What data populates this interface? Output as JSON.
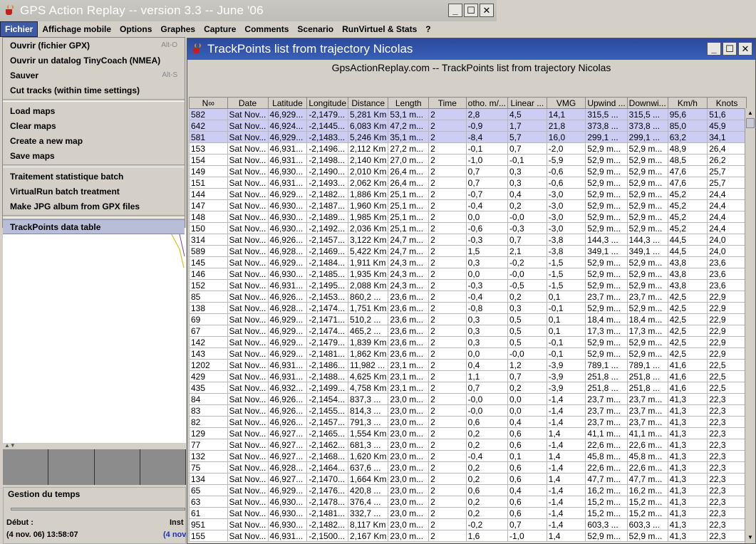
{
  "main_window": {
    "title": "GPS Action Replay -- version 3.3 -- June '06"
  },
  "menubar": [
    "Fichier",
    "Affichage mobile",
    "Options",
    "Graphes",
    "Capture",
    "Comments",
    "Scenario",
    "RunVirtuel & Stats",
    "?"
  ],
  "file_menu": {
    "items": [
      {
        "label": "Ouvrir (fichier GPX)",
        "shortcut": "Alt-O"
      },
      {
        "label": "Ouvrir un datalog TinyCoach (NMEA)",
        "shortcut": ""
      },
      {
        "label": "Sauver",
        "shortcut": "Alt-S"
      },
      {
        "label": "Cut tracks (within time settings)",
        "shortcut": ""
      },
      {
        "sep": true
      },
      {
        "label": "Load maps",
        "shortcut": ""
      },
      {
        "label": "Clear maps",
        "shortcut": ""
      },
      {
        "label": "Create a new map",
        "shortcut": ""
      },
      {
        "label": "Save maps",
        "shortcut": ""
      },
      {
        "sep": true
      },
      {
        "label": "Traitement statistique batch",
        "shortcut": ""
      },
      {
        "label": "VirtualRun batch treatment",
        "shortcut": ""
      },
      {
        "label": "Make JPG album from GPX files",
        "shortcut": ""
      },
      {
        "sep": true
      },
      {
        "label": "TrackPoints data table",
        "shortcut": "",
        "selected": true
      }
    ]
  },
  "time_panel": {
    "title": "Gestion du temps",
    "start_label": "Début :",
    "start_value": "(4 nov. 06) 13:58:07",
    "inst_label": "Inst",
    "inst_value": "(4 nov"
  },
  "trackpoints_window": {
    "title": "TrackPoints list from trajectory Nicolas",
    "subtitle": "GpsActionReplay.com -- TrackPoints list from trajectory Nicolas",
    "columns": [
      "N∞",
      "Date",
      "Latitude",
      "Longitude",
      "Distance",
      "Length",
      "Time",
      "otho. m/...",
      "Linear ...",
      "VMG",
      "Upwind ...",
      "Downwi...",
      "Km/h",
      "Knots"
    ],
    "rows": [
      [
        "582",
        "Sat Nov...",
        "46,929...",
        "-2,1479...",
        "5,281 Km",
        "53,1 m...",
        "2",
        "2,8",
        "4,5",
        "14,1",
        "315,5 ...",
        "315,5 ...",
        "95,6",
        "51,6"
      ],
      [
        "642",
        "Sat Nov...",
        "46,924...",
        "-2,1445...",
        "6,083 Km",
        "47,2 m...",
        "2",
        "-0,9",
        "1,7",
        "21,8",
        "373,8 ...",
        "373,8 ...",
        "85,0",
        "45,9"
      ],
      [
        "581",
        "Sat Nov...",
        "46,929...",
        "-2,1483...",
        "5,246 Km",
        "35,1 m...",
        "2",
        "-8,4",
        "5,7",
        "16,0",
        "299,1 ...",
        "299,1 ...",
        "63,2",
        "34,1"
      ],
      [
        "153",
        "Sat Nov...",
        "46,931...",
        "-2,1496...",
        "2,112 Km",
        "27,2 m...",
        "2",
        "-0,1",
        "0,7",
        "-2,0",
        "52,9 m...",
        "52,9 m...",
        "48,9",
        "26,4"
      ],
      [
        "154",
        "Sat Nov...",
        "46,931...",
        "-2,1498...",
        "2,140 Km",
        "27,0 m...",
        "2",
        "-1,0",
        "-0,1",
        "-5,9",
        "52,9 m...",
        "52,9 m...",
        "48,5",
        "26,2"
      ],
      [
        "149",
        "Sat Nov...",
        "46,930...",
        "-2,1490...",
        "2,010 Km",
        "26,4 m...",
        "2",
        "0,7",
        "0,3",
        "-0,6",
        "52,9 m...",
        "52,9 m...",
        "47,6",
        "25,7"
      ],
      [
        "151",
        "Sat Nov...",
        "46,931...",
        "-2,1493...",
        "2,062 Km",
        "26,4 m...",
        "2",
        "0,7",
        "0,3",
        "-0,6",
        "52,9 m...",
        "52,9 m...",
        "47,6",
        "25,7"
      ],
      [
        "144",
        "Sat Nov...",
        "46,929...",
        "-2,1482...",
        "1,886 Km",
        "25,1 m...",
        "2",
        "-0,7",
        "0,4",
        "-3,0",
        "52,9 m...",
        "52,9 m...",
        "45,2",
        "24,4"
      ],
      [
        "147",
        "Sat Nov...",
        "46,930...",
        "-2,1487...",
        "1,960 Km",
        "25,1 m...",
        "2",
        "-0,4",
        "0,2",
        "-3,0",
        "52,9 m...",
        "52,9 m...",
        "45,2",
        "24,4"
      ],
      [
        "148",
        "Sat Nov...",
        "46,930...",
        "-2,1489...",
        "1,985 Km",
        "25,1 m...",
        "2",
        "0,0",
        "-0,0",
        "-3,0",
        "52,9 m...",
        "52,9 m...",
        "45,2",
        "24,4"
      ],
      [
        "150",
        "Sat Nov...",
        "46,930...",
        "-2,1492...",
        "2,036 Km",
        "25,1 m...",
        "2",
        "-0,6",
        "-0,3",
        "-3,0",
        "52,9 m...",
        "52,9 m...",
        "45,2",
        "24,4"
      ],
      [
        "314",
        "Sat Nov...",
        "46,926...",
        "-2,1457...",
        "3,122 Km",
        "24,7 m...",
        "2",
        "-0,3",
        "0,7",
        "-3,8",
        "144,3 ...",
        "144,3 ...",
        "44,5",
        "24,0"
      ],
      [
        "589",
        "Sat Nov...",
        "46,928...",
        "-2,1469...",
        "5,422 Km",
        "24,7 m...",
        "2",
        "1,5",
        "2,1",
        "-3,8",
        "349,1 ...",
        "349,1 ...",
        "44,5",
        "24,0"
      ],
      [
        "145",
        "Sat Nov...",
        "46,929...",
        "-2,1484...",
        "1,911 Km",
        "24,3 m...",
        "2",
        "0,3",
        "-0,2",
        "-1,5",
        "52,9 m...",
        "52,9 m...",
        "43,8",
        "23,6"
      ],
      [
        "146",
        "Sat Nov...",
        "46,930...",
        "-2,1485...",
        "1,935 Km",
        "24,3 m...",
        "2",
        "0,0",
        "-0,0",
        "-1,5",
        "52,9 m...",
        "52,9 m...",
        "43,8",
        "23,6"
      ],
      [
        "152",
        "Sat Nov...",
        "46,931...",
        "-2,1495...",
        "2,088 Km",
        "24,3 m...",
        "2",
        "-0,3",
        "-0,5",
        "-1,5",
        "52,9 m...",
        "52,9 m...",
        "43,8",
        "23,6"
      ],
      [
        "85",
        "Sat Nov...",
        "46,926...",
        "-2,1453...",
        "860,2 ...",
        "23,6 m...",
        "2",
        "-0,4",
        "0,2",
        "0,1",
        "23,7 m...",
        "23,7 m...",
        "42,5",
        "22,9"
      ],
      [
        "138",
        "Sat Nov...",
        "46,928...",
        "-2,1474...",
        "1,751 Km",
        "23,6 m...",
        "2",
        "-0,8",
        "0,3",
        "-0,1",
        "52,9 m...",
        "52,9 m...",
        "42,5",
        "22,9"
      ],
      [
        "69",
        "Sat Nov...",
        "46,929...",
        "-2,1471...",
        "510,2 ...",
        "23,6 m...",
        "2",
        "0,3",
        "0,5",
        "0,1",
        "18,4 m...",
        "18,4 m...",
        "42,5",
        "22,9"
      ],
      [
        "67",
        "Sat Nov...",
        "46,929...",
        "-2,1474...",
        "465,2 ...",
        "23,6 m...",
        "2",
        "0,3",
        "0,5",
        "0,1",
        "17,3 m...",
        "17,3 m...",
        "42,5",
        "22,9"
      ],
      [
        "142",
        "Sat Nov...",
        "46,929...",
        "-2,1479...",
        "1,839 Km",
        "23,6 m...",
        "2",
        "0,3",
        "0,5",
        "-0,1",
        "52,9 m...",
        "52,9 m...",
        "42,5",
        "22,9"
      ],
      [
        "143",
        "Sat Nov...",
        "46,929...",
        "-2,1481...",
        "1,862 Km",
        "23,6 m...",
        "2",
        "0,0",
        "-0,0",
        "-0,1",
        "52,9 m...",
        "52,9 m...",
        "42,5",
        "22,9"
      ],
      [
        "1202",
        "Sat Nov...",
        "46,931...",
        "-2,1486...",
        "11,982 ...",
        "23,1 m...",
        "2",
        "0,4",
        "1,2",
        "-3,9",
        "789,1 ...",
        "789,1 ...",
        "41,6",
        "22,5"
      ],
      [
        "429",
        "Sat Nov...",
        "46,931...",
        "-2,1488...",
        "4,625 Km",
        "23,1 m...",
        "2",
        "1,1",
        "0,7",
        "-3,9",
        "251,8 ...",
        "251,8 ...",
        "41,6",
        "22,5"
      ],
      [
        "435",
        "Sat Nov...",
        "46,932...",
        "-2,1499...",
        "4,758 Km",
        "23,1 m...",
        "2",
        "0,7",
        "0,2",
        "-3,9",
        "251,8 ...",
        "251,8 ...",
        "41,6",
        "22,5"
      ],
      [
        "84",
        "Sat Nov...",
        "46,926...",
        "-2,1454...",
        "837,3 ...",
        "23,0 m...",
        "2",
        "-0,0",
        "0,0",
        "-1,4",
        "23,7 m...",
        "23,7 m...",
        "41,3",
        "22,3"
      ],
      [
        "83",
        "Sat Nov...",
        "46,926...",
        "-2,1455...",
        "814,3 ...",
        "23,0 m...",
        "2",
        "-0,0",
        "0,0",
        "-1,4",
        "23,7 m...",
        "23,7 m...",
        "41,3",
        "22,3"
      ],
      [
        "82",
        "Sat Nov...",
        "46,926...",
        "-2,1457...",
        "791,3 ...",
        "23,0 m...",
        "2",
        "0,6",
        "0,4",
        "-1,4",
        "23,7 m...",
        "23,7 m...",
        "41,3",
        "22,3"
      ],
      [
        "129",
        "Sat Nov...",
        "46,927...",
        "-2,1465...",
        "1,554 Km",
        "23,0 m...",
        "2",
        "0,2",
        "0,6",
        "1,4",
        "41,1 m...",
        "41,1 m...",
        "41,3",
        "22,3"
      ],
      [
        "77",
        "Sat Nov...",
        "46,927...",
        "-2,1462...",
        "681,3 ...",
        "23,0 m...",
        "2",
        "0,2",
        "0,6",
        "-1,4",
        "22,6 m...",
        "22,6 m...",
        "41,3",
        "22,3"
      ],
      [
        "132",
        "Sat Nov...",
        "46,927...",
        "-2,1468...",
        "1,620 Km",
        "23,0 m...",
        "2",
        "-0,4",
        "0,1",
        "1,4",
        "45,8 m...",
        "45,8 m...",
        "41,3",
        "22,3"
      ],
      [
        "75",
        "Sat Nov...",
        "46,928...",
        "-2,1464...",
        "637,6 ...",
        "23,0 m...",
        "2",
        "0,2",
        "0,6",
        "-1,4",
        "22,6 m...",
        "22,6 m...",
        "41,3",
        "22,3"
      ],
      [
        "134",
        "Sat Nov...",
        "46,927...",
        "-2,1470...",
        "1,664 Km",
        "23,0 m...",
        "2",
        "0,2",
        "0,6",
        "1,4",
        "47,7 m...",
        "47,7 m...",
        "41,3",
        "22,3"
      ],
      [
        "65",
        "Sat Nov...",
        "46,929...",
        "-2,1476...",
        "420,8 ...",
        "23,0 m...",
        "2",
        "0,6",
        "0,4",
        "-1,4",
        "16,2 m...",
        "16,2 m...",
        "41,3",
        "22,3"
      ],
      [
        "63",
        "Sat Nov...",
        "46,930...",
        "-2,1478...",
        "376,4 ...",
        "23,0 m...",
        "2",
        "0,2",
        "0,6",
        "-1,4",
        "15,2 m...",
        "15,2 m...",
        "41,3",
        "22,3"
      ],
      [
        "61",
        "Sat Nov...",
        "46,930...",
        "-2,1481...",
        "332,7 ...",
        "23,0 m...",
        "2",
        "0,2",
        "0,6",
        "-1,4",
        "15,2 m...",
        "15,2 m...",
        "41,3",
        "22,3"
      ],
      [
        "951",
        "Sat Nov...",
        "46,930...",
        "-2,1482...",
        "8,117 Km",
        "23,0 m...",
        "2",
        "-0,2",
        "0,7",
        "-1,4",
        "603,3 ...",
        "603,3 ...",
        "41,3",
        "22,3"
      ],
      [
        "155",
        "Sat Nov...",
        "46,931...",
        "-2,1500...",
        "2,167 Km",
        "23,0 m...",
        "2",
        "1,6",
        "-1,0",
        "1,4",
        "52,9 m...",
        "52,9 m...",
        "41,3",
        "22,3"
      ]
    ],
    "highlighted_rows": [
      0,
      1,
      2
    ]
  }
}
